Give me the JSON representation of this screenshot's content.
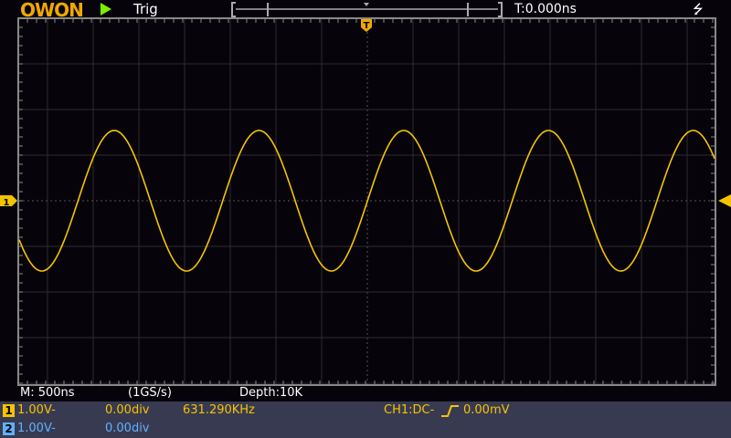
{
  "header": {
    "logo": "OWON",
    "run_icon": "play-icon",
    "trig_status": "Trig",
    "trigger_time": "T:0.000ns",
    "usb_icon": "usb-icon"
  },
  "info": {
    "timebase": "M: 500ns",
    "sample_rate": "(1GS/s)",
    "depth": "Depth:10K"
  },
  "channels": [
    {
      "num": "1",
      "scale": "1.00V-",
      "offset": "0.00div",
      "frequency": "631.290KHz",
      "color": "#f5c400"
    },
    {
      "num": "2",
      "scale": "1.00V-",
      "offset": "0.00div",
      "color": "#5fb2ff"
    }
  ],
  "trigger": {
    "label": "CH1:DC-",
    "edge_icon": "rising-edge-icon",
    "level": "0.00mV"
  },
  "waveform": {
    "channel": "1",
    "frequency_khz": 631.29,
    "amplitude_div": 1.54,
    "timebase_ns_per_div": 500,
    "color": "#f5c400"
  }
}
